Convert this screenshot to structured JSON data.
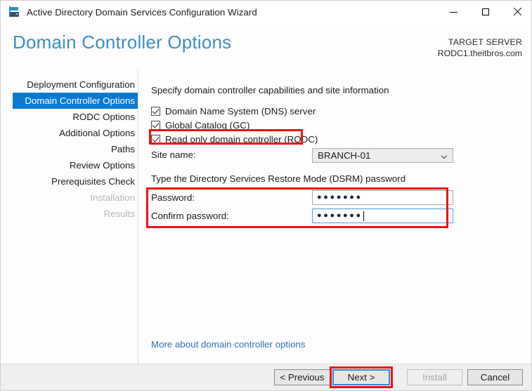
{
  "window": {
    "title": "Active Directory Domain Services Configuration Wizard",
    "app_icon": "server-wizard-icon",
    "controls": {
      "minimize": "minimize-icon",
      "maximize": "maximize-icon",
      "close": "close-icon"
    }
  },
  "header": {
    "page_title": "Domain Controller Options",
    "target_server_label": "TARGET SERVER",
    "target_server_name": "RODC1.theitbros.com",
    "title_color": "#3d8fbf"
  },
  "sidebar": {
    "items": [
      {
        "label": "Deployment Configuration",
        "state": "normal"
      },
      {
        "label": "Domain Controller Options",
        "state": "active"
      },
      {
        "label": "RODC Options",
        "state": "normal"
      },
      {
        "label": "Additional Options",
        "state": "normal"
      },
      {
        "label": "Paths",
        "state": "normal"
      },
      {
        "label": "Review Options",
        "state": "normal"
      },
      {
        "label": "Prerequisites Check",
        "state": "normal"
      },
      {
        "label": "Installation",
        "state": "disabled"
      },
      {
        "label": "Results",
        "state": "disabled"
      }
    ],
    "active_color": "#0a7ad0"
  },
  "content": {
    "capabilities_label": "Specify domain controller capabilities and site information",
    "checkboxes": [
      {
        "label": "Domain Name System (DNS) server",
        "checked": true
      },
      {
        "label": "Global Catalog (GC)",
        "checked": true
      },
      {
        "label": "Read only domain controller (RODC)",
        "checked": true
      }
    ],
    "site_name_label": "Site name:",
    "site_name_value": "BRANCH-01",
    "dsrm_label": "Type the Directory Services Restore Mode (DSRM) password",
    "password_label": "Password:",
    "password_value": "●●●●●●●",
    "confirm_label": "Confirm password:",
    "confirm_value": "●●●●●●●",
    "more_link": "More about domain controller options"
  },
  "footer": {
    "previous": "< Previous",
    "next": "Next >",
    "install": "Install",
    "cancel": "Cancel"
  },
  "annotations": {
    "color": "#ee1111",
    "boxes": [
      "rodc-checkbox",
      "dsrm-password-section",
      "next-button"
    ]
  }
}
